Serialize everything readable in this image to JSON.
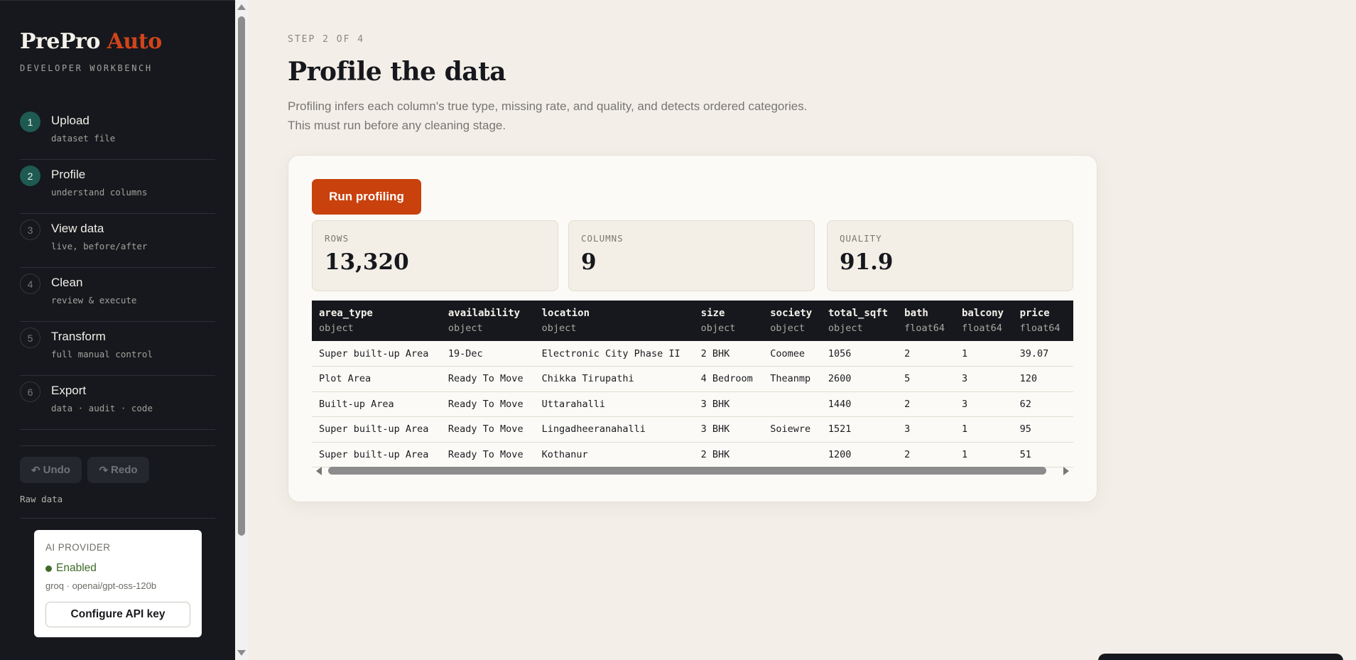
{
  "sidebar": {
    "brand_part1": "PrePro",
    "brand_part2": "Auto",
    "subtitle": "DEVELOPER WORKBENCH",
    "steps": [
      {
        "num": "1",
        "title": "Upload",
        "sub": "dataset file",
        "state": "active"
      },
      {
        "num": "2",
        "title": "Profile",
        "sub": "understand columns",
        "state": "active"
      },
      {
        "num": "3",
        "title": "View data",
        "sub": "live, before/after",
        "state": "inactive"
      },
      {
        "num": "4",
        "title": "Clean",
        "sub": "review & execute",
        "state": "inactive"
      },
      {
        "num": "5",
        "title": "Transform",
        "sub": "full manual control",
        "state": "inactive"
      },
      {
        "num": "6",
        "title": "Export",
        "sub": "data · audit · code",
        "state": "inactive"
      }
    ],
    "undo_label": "Undo",
    "redo_label": "Redo",
    "undo_icon": "↶",
    "redo_icon": "↷",
    "history_label": "Raw data",
    "ai_provider": {
      "title": "AI PROVIDER",
      "status": "Enabled",
      "status_color": "#3e6b2a",
      "model": "groq · openai/gpt-oss-120b",
      "button_label": "Configure API key"
    }
  },
  "main": {
    "step_label": "STEP 2 OF 4",
    "title": "Profile the data",
    "desc_line1": "Profiling infers each column's true type, missing rate, and quality, and detects ordered categories.",
    "desc_line2": "This must run before any cleaning stage.",
    "run_button": "Run profiling",
    "accent_color": "#c9410d",
    "metrics": [
      {
        "label": "ROWS",
        "value": "13,320"
      },
      {
        "label": "COLUMNS",
        "value": "9"
      },
      {
        "label": "QUALITY",
        "value": "91.9"
      }
    ],
    "table": {
      "columns": [
        {
          "name": "area_type",
          "type": "object"
        },
        {
          "name": "availability",
          "type": "object"
        },
        {
          "name": "location",
          "type": "object"
        },
        {
          "name": "size",
          "type": "object"
        },
        {
          "name": "society",
          "type": "object"
        },
        {
          "name": "total_sqft",
          "type": "object"
        },
        {
          "name": "bath",
          "type": "float64"
        },
        {
          "name": "balcony",
          "type": "float64"
        },
        {
          "name": "price",
          "type": "float64"
        }
      ],
      "rows": [
        [
          "Super built-up Area",
          "19-Dec",
          "Electronic City Phase II",
          "2 BHK",
          "Coomee",
          "1056",
          "2",
          "1",
          "39.07"
        ],
        [
          "Plot Area",
          "Ready To Move",
          "Chikka Tirupathi",
          "4 Bedroom",
          "Theanmp",
          "2600",
          "5",
          "3",
          "120"
        ],
        [
          "Built-up Area",
          "Ready To Move",
          "Uttarahalli",
          "3 BHK",
          "",
          "1440",
          "2",
          "3",
          "62"
        ],
        [
          "Super built-up Area",
          "Ready To Move",
          "Lingadheeranahalli",
          "3 BHK",
          "Soiewre",
          "1521",
          "3",
          "1",
          "95"
        ],
        [
          "Super built-up Area",
          "Ready To Move",
          "Kothanur",
          "2 BHK",
          "",
          "1200",
          "2",
          "1",
          "51"
        ]
      ]
    }
  }
}
